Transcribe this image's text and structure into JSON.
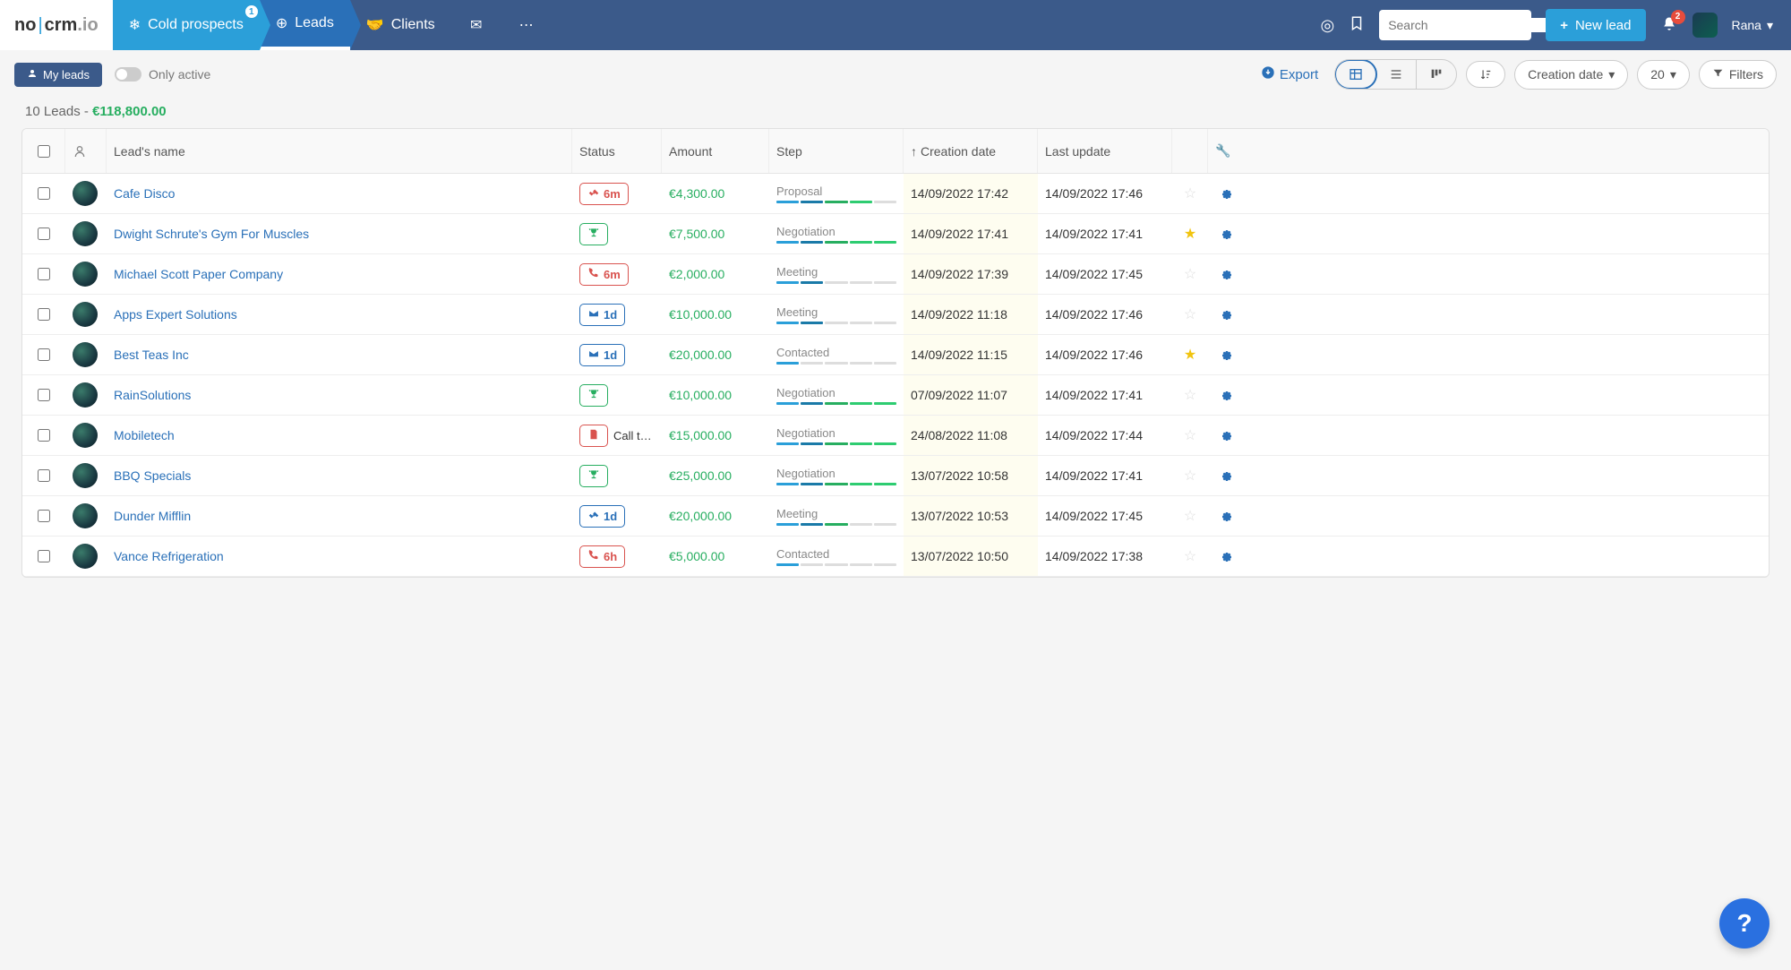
{
  "nav": {
    "logo_no": "no",
    "logo_crm": "crm",
    "logo_io": ".io",
    "tab_prospects": "Cold prospects",
    "prospects_badge": "1",
    "tab_leads": "Leads",
    "tab_clients": "Clients",
    "search_placeholder": "Search",
    "new_lead": "New lead",
    "notif_count": "2",
    "user_name": "Rana"
  },
  "sub": {
    "my_leads": "My leads",
    "only_active": "Only active",
    "export": "Export",
    "sort_by": "Creation date",
    "page_size": "20",
    "filters": "Filters"
  },
  "summary": {
    "count_text": "10 Leads -",
    "total": "€118,800.00"
  },
  "columns": {
    "name": "Lead's name",
    "status": "Status",
    "amount": "Amount",
    "step": "Step",
    "creation": "Creation date",
    "update": "Last update"
  },
  "rows": [
    {
      "name": "Cafe Disco",
      "status_icon": "handshake",
      "status_color": "red",
      "status_text": "6m",
      "amount": "€4,300.00",
      "step": "Proposal",
      "step_prog": 4,
      "created": "14/09/2022 17:42",
      "updated": "14/09/2022 17:46",
      "star": false
    },
    {
      "name": "Dwight Schrute's Gym For Muscles",
      "status_icon": "trophy",
      "status_color": "green",
      "status_text": "",
      "amount": "€7,500.00",
      "step": "Negotiation",
      "step_prog": 5,
      "created": "14/09/2022 17:41",
      "updated": "14/09/2022 17:41",
      "star": true
    },
    {
      "name": "Michael Scott Paper Company",
      "status_icon": "phone",
      "status_color": "red",
      "status_text": "6m",
      "amount": "€2,000.00",
      "step": "Meeting",
      "step_prog": 2,
      "created": "14/09/2022 17:39",
      "updated": "14/09/2022 17:45",
      "star": false
    },
    {
      "name": "Apps Expert Solutions",
      "status_icon": "mail",
      "status_color": "blue",
      "status_text": "1d",
      "amount": "€10,000.00",
      "step": "Meeting",
      "step_prog": 2,
      "created": "14/09/2022 11:18",
      "updated": "14/09/2022 17:46",
      "star": false
    },
    {
      "name": "Best Teas Inc",
      "status_icon": "mail",
      "status_color": "blue",
      "status_text": "1d",
      "amount": "€20,000.00",
      "step": "Contacted",
      "step_prog": 1,
      "created": "14/09/2022 11:15",
      "updated": "14/09/2022 17:46",
      "star": true
    },
    {
      "name": "RainSolutions",
      "status_icon": "trophy",
      "status_color": "green",
      "status_text": "",
      "amount": "€10,000.00",
      "step": "Negotiation",
      "step_prog": 5,
      "created": "07/09/2022 11:07",
      "updated": "14/09/2022 17:41",
      "star": false
    },
    {
      "name": "Mobiletech",
      "status_icon": "doc",
      "status_color": "red",
      "status_text": "",
      "status_extra": "Call to ...",
      "amount": "€15,000.00",
      "step": "Negotiation",
      "step_prog": 5,
      "created": "24/08/2022 11:08",
      "updated": "14/09/2022 17:44",
      "star": false
    },
    {
      "name": "BBQ Specials",
      "status_icon": "trophy",
      "status_color": "green",
      "status_text": "",
      "amount": "€25,000.00",
      "step": "Negotiation",
      "step_prog": 5,
      "created": "13/07/2022 10:58",
      "updated": "14/09/2022 17:41",
      "star": false
    },
    {
      "name": "Dunder Mifflin",
      "status_icon": "handshake",
      "status_color": "blue",
      "status_text": "1d",
      "amount": "€20,000.00",
      "step": "Meeting",
      "step_prog": 3,
      "created": "13/07/2022 10:53",
      "updated": "14/09/2022 17:45",
      "star": false
    },
    {
      "name": "Vance Refrigeration",
      "status_icon": "phone",
      "status_color": "red",
      "status_text": "6h",
      "amount": "€5,000.00",
      "step": "Contacted",
      "step_prog": 1,
      "created": "13/07/2022 10:50",
      "updated": "14/09/2022 17:38",
      "star": false
    }
  ]
}
